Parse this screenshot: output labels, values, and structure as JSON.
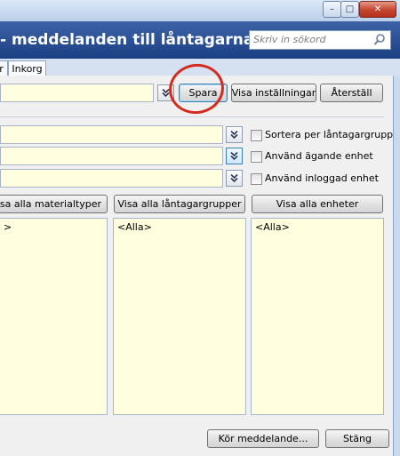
{
  "window": {
    "title_left": "",
    "title_right": "",
    "minimize_glyph": "–",
    "maximize_glyph": "□",
    "close_glyph": "✕"
  },
  "ribbon": {
    "title": "- meddelanden till låntagarna",
    "search_placeholder": "Skriv in sökord"
  },
  "tabs": [
    {
      "label": "r"
    },
    {
      "label": "Inkorg"
    }
  ],
  "toolbar": {
    "save_label": "Spara",
    "show_settings_label": "Visa inställningar",
    "reset_label": "Återställ"
  },
  "options": {
    "sort_by_group": "Sortera per låntagargrupp",
    "use_owning_unit": "Använd ägande enhet",
    "use_logged_in_unit": "Använd inloggad enhet"
  },
  "lists": {
    "show_all_materials": "sa alla materialtyper",
    "show_all_groups": "Visa alla låntagargrupper",
    "show_all_units": "Visa alla enheter",
    "material_value": ">",
    "group_value": "<Alla>",
    "unit_value": "<Alla>"
  },
  "footer": {
    "run_label": "Kör meddelande...",
    "close_label": "Stäng"
  },
  "colors": {
    "ribbon": "#1c3f83",
    "field_bg": "#ffffe0",
    "highlight_circle": "#d42a20"
  }
}
